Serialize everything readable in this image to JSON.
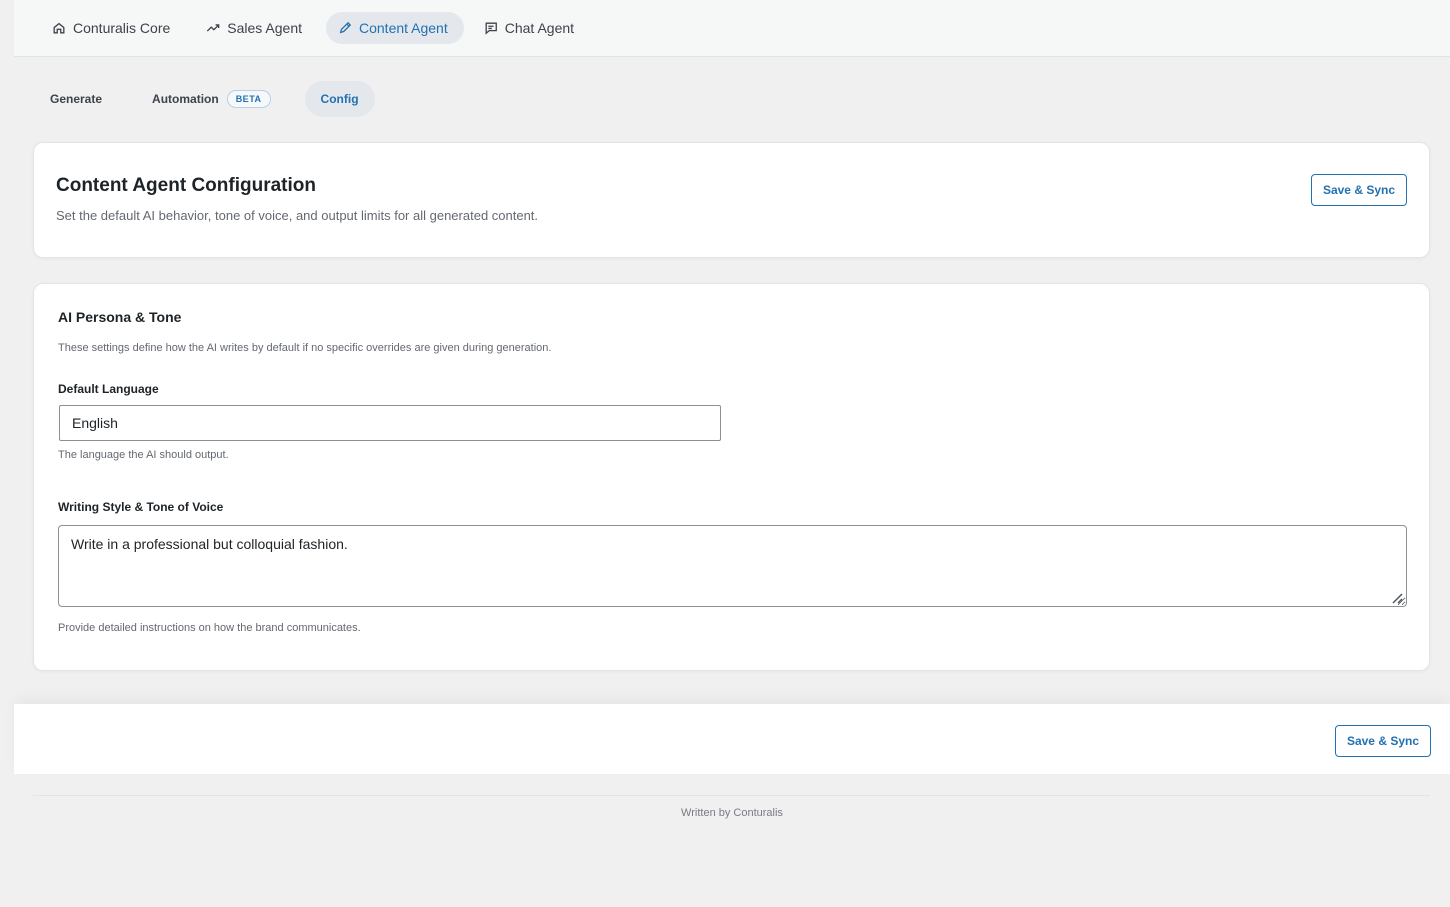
{
  "top_nav": {
    "tabs": [
      {
        "label": "Conturalis Core",
        "icon": "home-icon"
      },
      {
        "label": "Sales Agent",
        "icon": "trend-icon"
      },
      {
        "label": "Content Agent",
        "icon": "pencil-icon",
        "active": true
      },
      {
        "label": "Chat Agent",
        "icon": "chat-icon"
      }
    ]
  },
  "sub_nav": {
    "tabs": [
      {
        "label": "Generate"
      },
      {
        "label": "Automation",
        "badge": "BETA"
      },
      {
        "label": "Config",
        "active": true
      }
    ]
  },
  "header": {
    "title": "Content Agent Configuration",
    "description": "Set the default AI behavior, tone of voice, and output limits for all generated content.",
    "save_label": "Save & Sync"
  },
  "persona": {
    "title": "AI Persona & Tone",
    "description": "These settings define how the AI writes by default if no specific overrides are given during generation.",
    "language": {
      "label": "Default Language",
      "value": "English",
      "help": "The language the AI should output."
    },
    "style": {
      "label": "Writing Style & Tone of Voice",
      "value": "Write in a professional but colloquial fashion.",
      "help": "Provide detailed instructions on how the brand communicates."
    }
  },
  "footer": {
    "save_label": "Save & Sync",
    "credit": "Written by Conturalis"
  },
  "colors": {
    "accent": "#2271b1",
    "active_tab_bg": "#e4e8ec",
    "page_bg": "#f0f0f1"
  }
}
